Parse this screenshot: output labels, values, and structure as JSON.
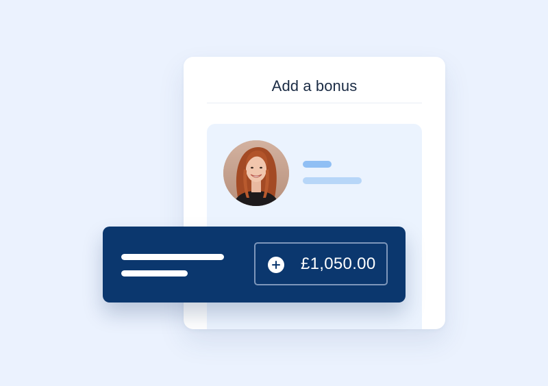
{
  "card": {
    "title": "Add a bonus"
  },
  "bonus": {
    "amount": "£1,050.00",
    "add_icon": "plus-circle-icon"
  },
  "colors": {
    "background": "#ebf2fe",
    "bar": "#0b376e",
    "placeholder_dark": "#90bff4",
    "placeholder_light": "#b7d6f8"
  }
}
